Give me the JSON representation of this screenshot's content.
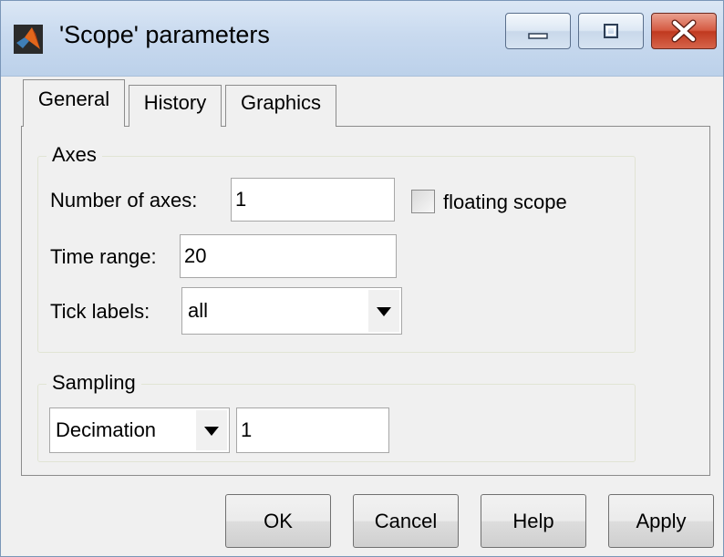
{
  "window": {
    "title": "'Scope' parameters",
    "icon": "matlab-logo-icon",
    "controls": [
      "minimize-icon",
      "maximize-icon",
      "close-icon"
    ]
  },
  "tabs": [
    {
      "label": "General",
      "selected": true
    },
    {
      "label": "History",
      "selected": false
    },
    {
      "label": "Graphics",
      "selected": false
    }
  ],
  "axes": {
    "group_label": "Axes",
    "number_of_axes_label": "Number of axes:",
    "number_of_axes_value": "1",
    "floating_scope_label": "floating scope",
    "floating_scope_checked": false,
    "time_range_label": "Time range:",
    "time_range_value": "20",
    "tick_labels_label": "Tick labels:",
    "tick_labels_value": "all"
  },
  "sampling": {
    "group_label": "Sampling",
    "mode_value": "Decimation",
    "factor_value": "1"
  },
  "buttons": {
    "ok": "OK",
    "cancel": "Cancel",
    "help": "Help",
    "apply": "Apply"
  },
  "colors": {
    "close_button": "#c0391f",
    "titlebar": "#c9daef",
    "face": "#f0f0f0"
  }
}
